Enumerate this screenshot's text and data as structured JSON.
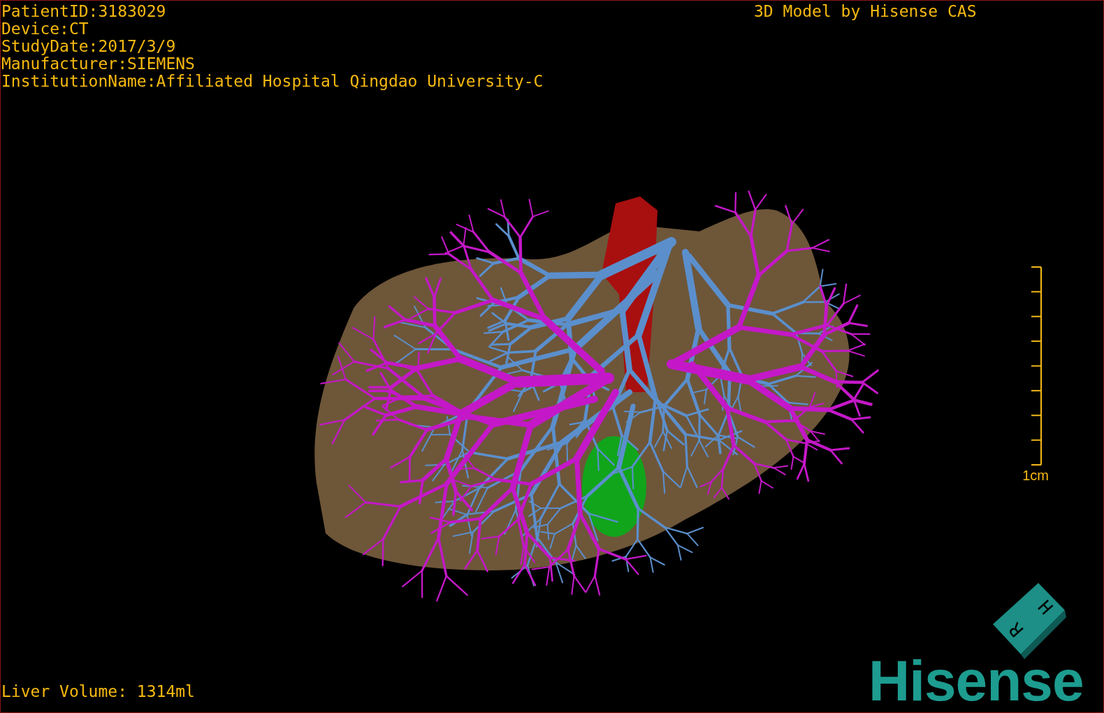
{
  "viewport": {
    "info_lines": [
      "PatientID:3183029",
      "Device:CT",
      "StudyDate:2017/3/9",
      "Manufacturer:SIEMENS",
      "InstitutionName:Affiliated Hospital Qingdao University-C"
    ],
    "model_credit": "3D Model by Hisense CAS",
    "scale_bar": {
      "label": "1cm"
    },
    "orientation_cube": {
      "faces": [
        "H",
        "R"
      ]
    },
    "logo": {
      "text": "Hisense"
    },
    "measurement": "Liver Volume: 1314ml"
  }
}
